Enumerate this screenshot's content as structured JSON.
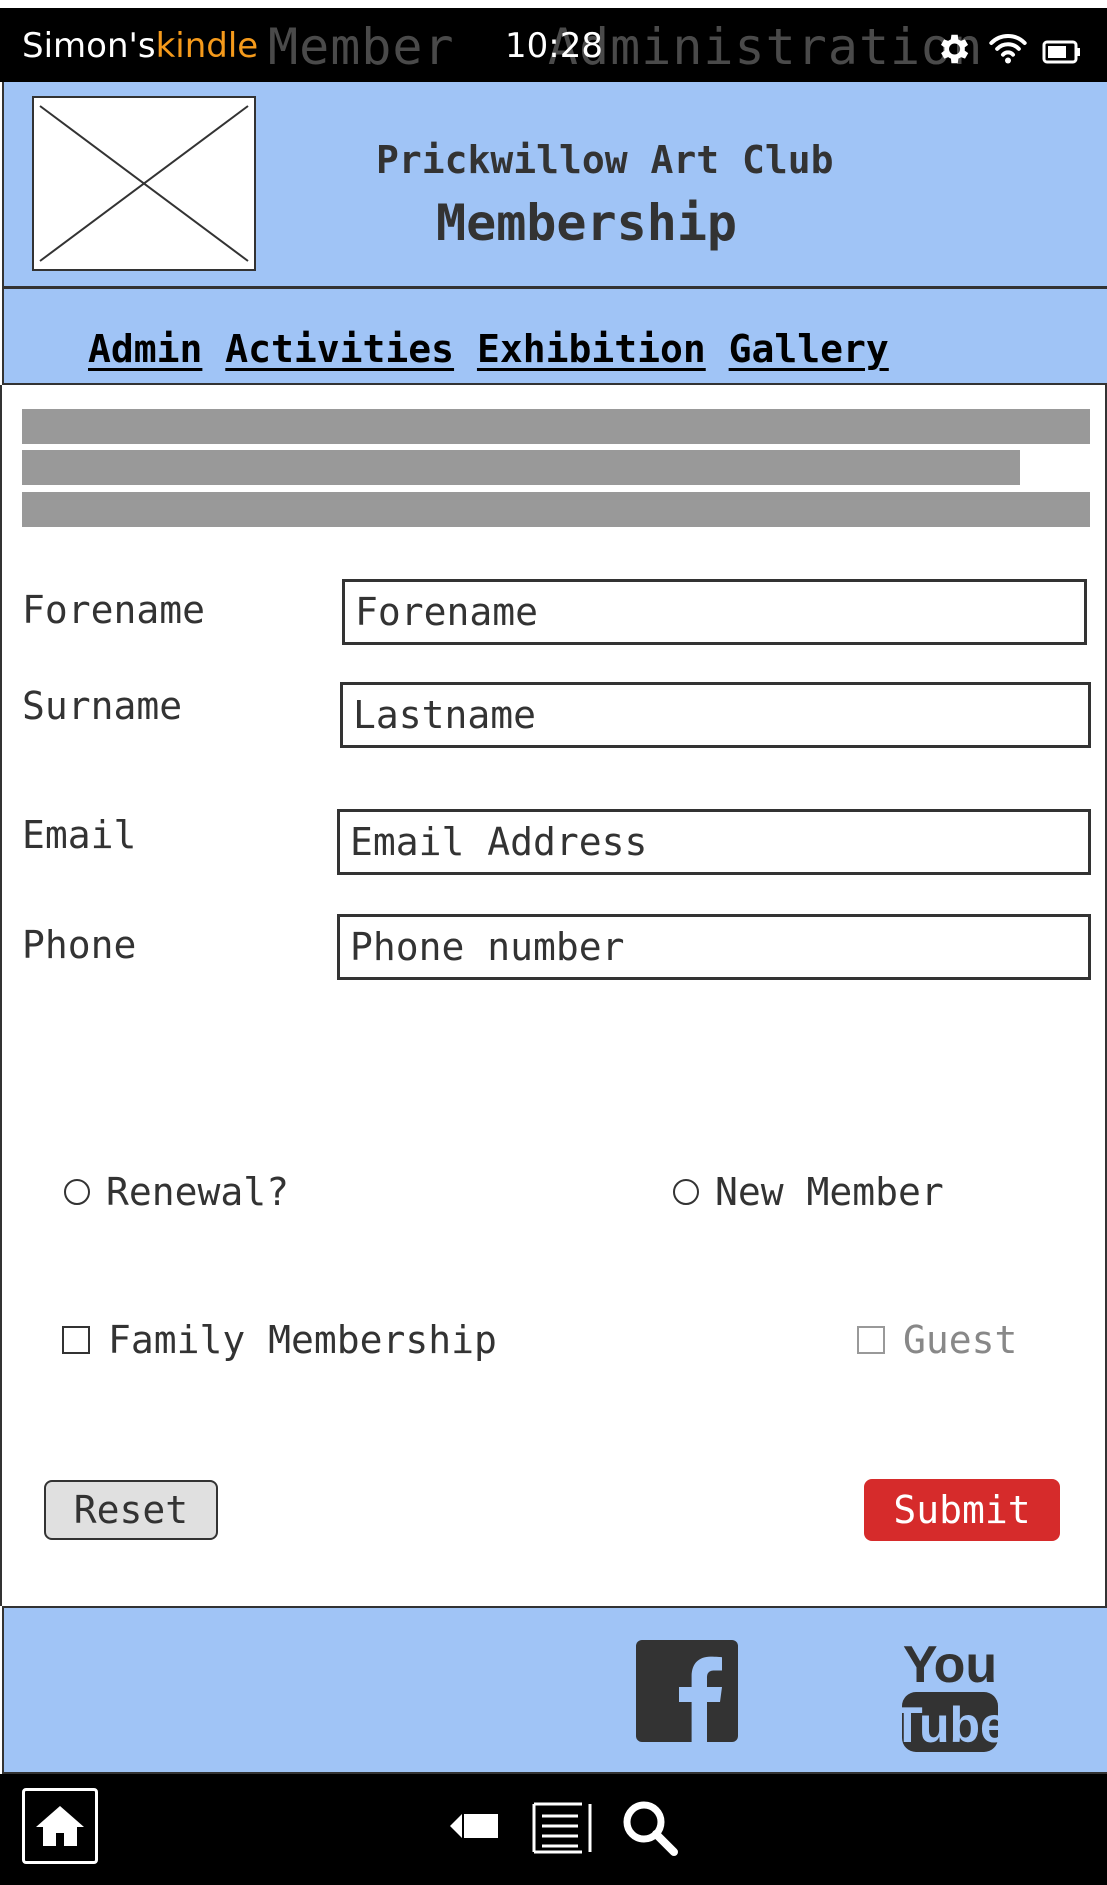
{
  "status_bar": {
    "device_owner": "Simon's",
    "device_brand": "kindle",
    "ghost_title": "Member   Administration",
    "time": "10:28",
    "icons": [
      "gear-icon",
      "wifi-icon",
      "battery-icon"
    ]
  },
  "header": {
    "logo": "image-placeholder",
    "club_name": "Prickwillow Art Club",
    "page_title": "Membership"
  },
  "nav": {
    "links": [
      "Admin",
      "Activities",
      "Exhibition",
      "Gallery"
    ]
  },
  "form": {
    "forename": {
      "label": "Forename",
      "placeholder": "Forename"
    },
    "surname": {
      "label": "Surname",
      "placeholder": "Lastname"
    },
    "email": {
      "label": "Email",
      "placeholder": "Email Address"
    },
    "phone": {
      "label": "Phone",
      "placeholder": "Phone number"
    },
    "radio_renewal": "Renewal?",
    "radio_new_member": "New Member",
    "check_family": "Family Membership",
    "check_guest": "Guest",
    "reset_label": "Reset",
    "submit_label": "Submit"
  },
  "colors": {
    "header_bg": "#a0c4f6",
    "submit_bg": "#d62b2b",
    "brand_orange": "#f59a1b",
    "placeholder_text_bar": "#999999"
  },
  "footer": {
    "icons": [
      "facebook-icon",
      "youtube-icon"
    ]
  },
  "bottom_bar": {
    "icons": [
      "home-icon",
      "back-icon",
      "menu-icon",
      "search-icon"
    ]
  }
}
